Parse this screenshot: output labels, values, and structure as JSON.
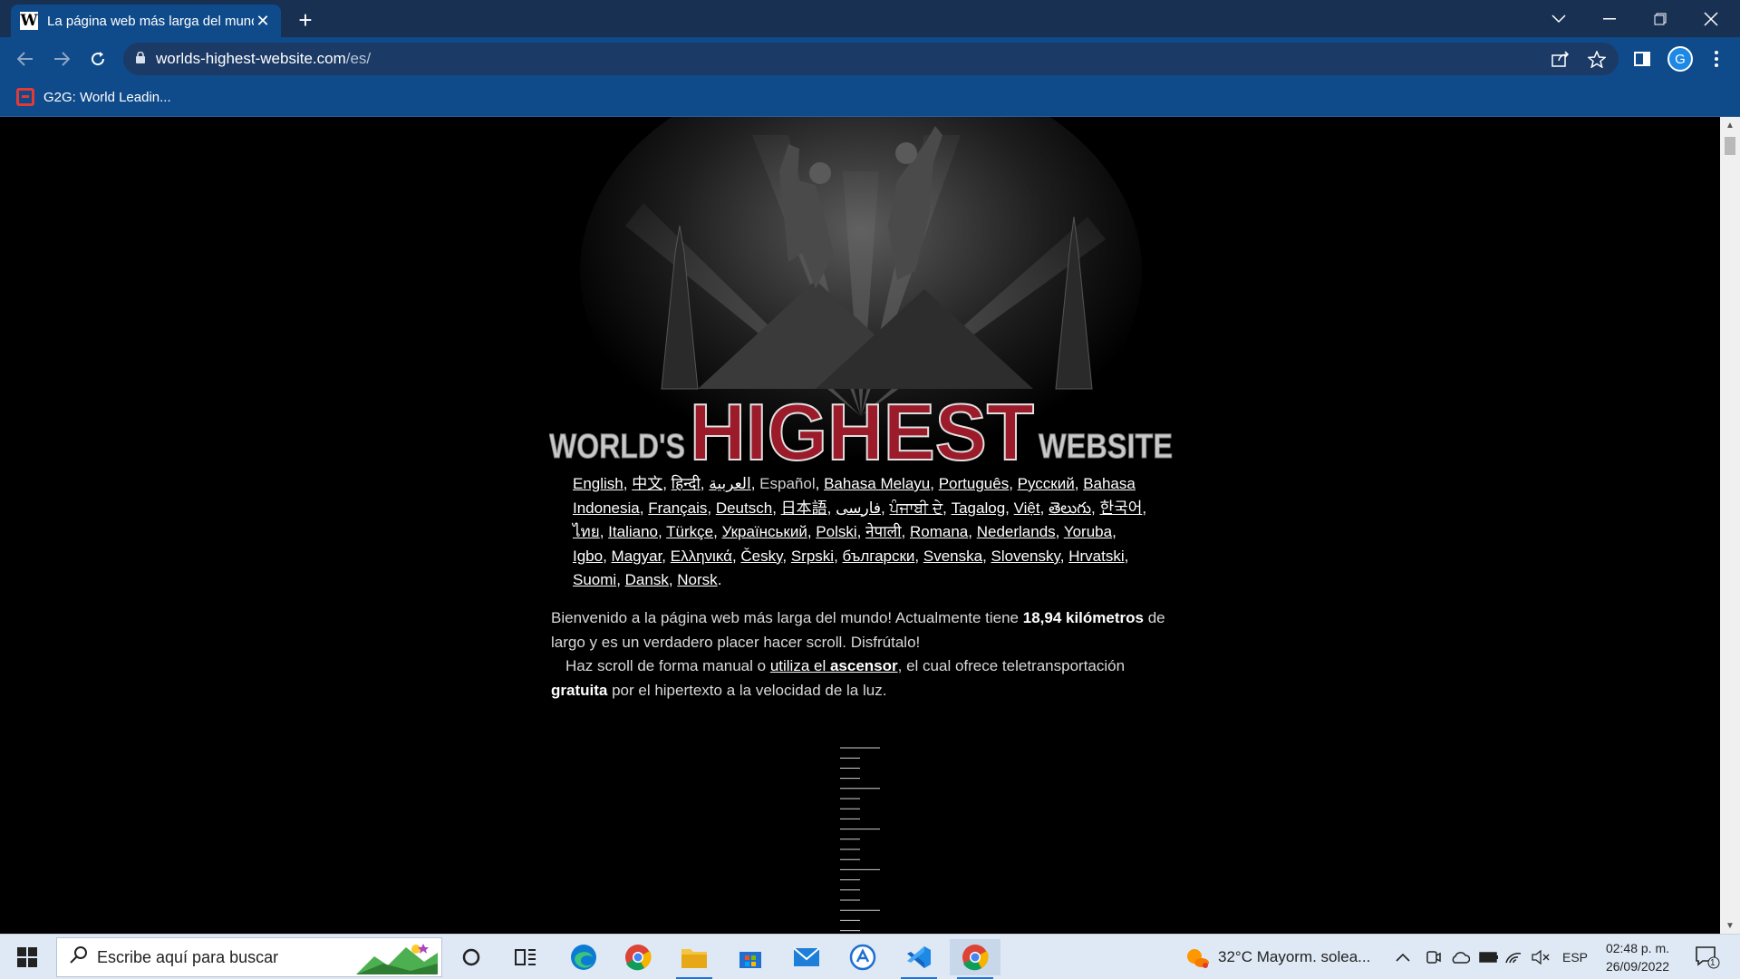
{
  "browser": {
    "tab_title": "La página web más larga del mundo",
    "favicon_letter": "W",
    "url_domain": "worlds-highest-website.com",
    "url_path": "/es/",
    "profile_initial": "G",
    "bookmark_label": "G2G: World Leadin..."
  },
  "page": {
    "logo": {
      "left": "WORLD'S",
      "center": "HIGHEST",
      "right": "WEBSITE"
    },
    "languages": [
      {
        "t": "English",
        "link": true,
        "sep": ", "
      },
      {
        "t": "中文",
        "link": true,
        "sep": ", "
      },
      {
        "t": "हिन्दी",
        "link": true,
        "sep": ", "
      },
      {
        "t": "العربية",
        "link": true,
        "sep": ", "
      },
      {
        "t": "Español",
        "link": false,
        "sep": ", "
      },
      {
        "t": "Bahasa Melayu",
        "link": true,
        "sep": ", "
      },
      {
        "t": "Português",
        "link": true,
        "sep": ", "
      },
      {
        "t": "Русский",
        "link": true,
        "sep": ", "
      },
      {
        "t": "Bahasa Indonesia",
        "link": true,
        "sep": ", "
      },
      {
        "t": "Français",
        "link": true,
        "sep": ", "
      },
      {
        "t": "Deutsch",
        "link": true,
        "sep": ", "
      },
      {
        "t": "日本語",
        "link": true,
        "sep": ", "
      },
      {
        "t": "فارسی",
        "link": true,
        "sep": ", "
      },
      {
        "t": "ਪੰਜਾਬੀ ਦੇ",
        "link": true,
        "sep": ", "
      },
      {
        "t": "Tagalog",
        "link": true,
        "sep": ", "
      },
      {
        "t": "Việt",
        "link": true,
        "sep": ", "
      },
      {
        "t": "తెలుగు",
        "link": true,
        "sep": ", "
      },
      {
        "t": "한국어",
        "link": true,
        "sep": ", "
      },
      {
        "t": "ไทย",
        "link": true,
        "sep": ", "
      },
      {
        "t": "Italiano",
        "link": true,
        "sep": ", "
      },
      {
        "t": "Türkçe",
        "link": true,
        "sep": ", "
      },
      {
        "t": "Український",
        "link": true,
        "sep": ", "
      },
      {
        "t": "Polski",
        "link": true,
        "sep": ", "
      },
      {
        "t": "नेपाली",
        "link": true,
        "sep": ", "
      },
      {
        "t": "Romana",
        "link": true,
        "sep": ", "
      },
      {
        "t": "Nederlands",
        "link": true,
        "sep": ", "
      },
      {
        "t": "Yoruba",
        "link": true,
        "sep": ", "
      },
      {
        "t": "Igbo",
        "link": true,
        "sep": ", "
      },
      {
        "t": "Magyar",
        "link": true,
        "sep": ", "
      },
      {
        "t": "Ελληνικά",
        "link": true,
        "sep": ", "
      },
      {
        "t": "Česky",
        "link": true,
        "sep": ", "
      },
      {
        "t": "Srpski",
        "link": true,
        "sep": ", "
      },
      {
        "t": "български",
        "link": true,
        "sep": ", "
      },
      {
        "t": "Svenska",
        "link": true,
        "sep": ", "
      },
      {
        "t": "Slovensky",
        "link": true,
        "sep": ", "
      },
      {
        "t": "Hrvatski",
        "link": true,
        "sep": ", "
      },
      {
        "t": "Suomi",
        "link": true,
        "sep": ", "
      },
      {
        "t": "Dansk",
        "link": true,
        "sep": ", "
      },
      {
        "t": "Norsk",
        "link": true,
        "sep": "."
      }
    ],
    "intro": {
      "p1_a": "Bienvenido a la página web más larga del mundo! Actualmente tiene ",
      "p1_bold": "18,94 kilómetros",
      "p1_b": " de largo y es un verdadero placer hacer scroll. Disfrútalo!",
      "p2_a": "Haz scroll de forma manual o ",
      "p2_link_a": "utiliza el ",
      "p2_link_b": "ascensor",
      "p2_b": ", el cual ofrece teletransportación ",
      "p2_bold": "gratuita",
      "p2_c": " por el hipertexto a la velocidad de la luz."
    }
  },
  "taskbar": {
    "search_placeholder": "Escribe aquí para buscar",
    "weather": "32°C  Mayorm. solea...",
    "language": "ESP",
    "time": "02:48 p. m.",
    "date": "26/09/2022",
    "notification_count": "1",
    "apps": [
      "cortana-icon",
      "task-view-icon",
      "edge-icon",
      "chrome-icon",
      "file-explorer-icon",
      "microsoft-store-icon",
      "mail-icon",
      "azure-data-studio-icon",
      "vscode-icon",
      "chrome-active-icon"
    ]
  }
}
